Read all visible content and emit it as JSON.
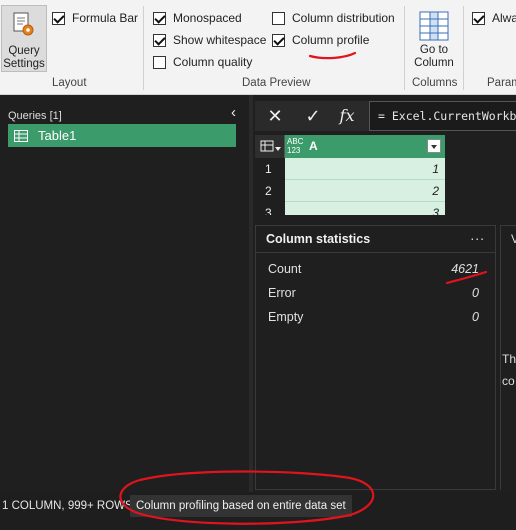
{
  "ribbon": {
    "query_settings": {
      "line1": "Query",
      "line2": "Settings"
    },
    "formula_bar": {
      "label": "Formula Bar",
      "checked": true
    },
    "layout_label": "Layout",
    "monospaced": {
      "label": "Monospaced",
      "checked": true
    },
    "show_whitespace": {
      "label": "Show whitespace",
      "checked": true
    },
    "column_quality": {
      "label": "Column quality",
      "checked": false
    },
    "column_distribution": {
      "label": "Column distribution",
      "checked": false
    },
    "column_profile": {
      "label": "Column profile",
      "checked": true
    },
    "data_preview_label": "Data Preview",
    "go_to_column": {
      "line1": "Go to",
      "line2": "Column"
    },
    "columns_label": "Columns",
    "always_label": "Alwa",
    "param_label": "Param"
  },
  "queries": {
    "header": "Queries [1]",
    "items": [
      {
        "label": "Table1"
      }
    ]
  },
  "formula": {
    "fx": "fx",
    "text": "= Excel.CurrentWorkbo"
  },
  "grid": {
    "column": {
      "type_line1": "ABC",
      "type_line2": "123",
      "name": "A"
    },
    "rows": [
      {
        "num": "1",
        "value": "1"
      },
      {
        "num": "2",
        "value": "2"
      },
      {
        "num": "3",
        "value": "3"
      }
    ]
  },
  "stats": {
    "title": "Column statistics",
    "more": "...",
    "items": [
      {
        "label": "Count",
        "value": "4621"
      },
      {
        "label": "Error",
        "value": "0"
      },
      {
        "label": "Empty",
        "value": "0"
      }
    ]
  },
  "side_panel": {
    "line1": "V",
    "line2": "Th",
    "line3": "co"
  },
  "status": {
    "left": "1 COLUMN, 999+ ROWS",
    "profile": "Column profiling based on entire data set"
  },
  "colors": {
    "accent": "#3b9b6a",
    "annotation": "#e0141e"
  }
}
